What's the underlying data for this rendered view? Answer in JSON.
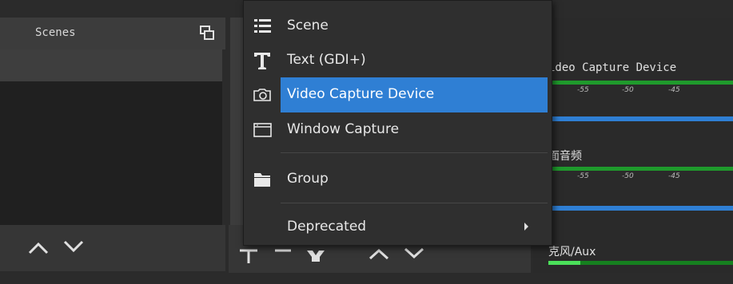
{
  "scenes": {
    "title": "Scenes"
  },
  "context_menu": {
    "items": [
      {
        "label": "Scene",
        "icon": "list-icon"
      },
      {
        "label": "Text (GDI+)",
        "icon": "text-icon"
      },
      {
        "label": "Video Capture Device",
        "icon": "camera-icon",
        "highlighted": true
      },
      {
        "label": "Window Capture",
        "icon": "window-icon"
      },
      {
        "label": "Group",
        "icon": "folder-icon"
      },
      {
        "label": "Deprecated",
        "icon": "",
        "has_submenu": true
      }
    ]
  },
  "mixer": {
    "channels": [
      {
        "name": "ideo Capture Device"
      },
      {
        "name": "面音频"
      },
      {
        "name": "克风/Aux"
      }
    ],
    "scale_labels": [
      "-55",
      "-50",
      "-45"
    ]
  },
  "colors": {
    "highlight": "#2f7fd4",
    "meter": "#1f9a2c",
    "panel": "#2b2b2b"
  }
}
